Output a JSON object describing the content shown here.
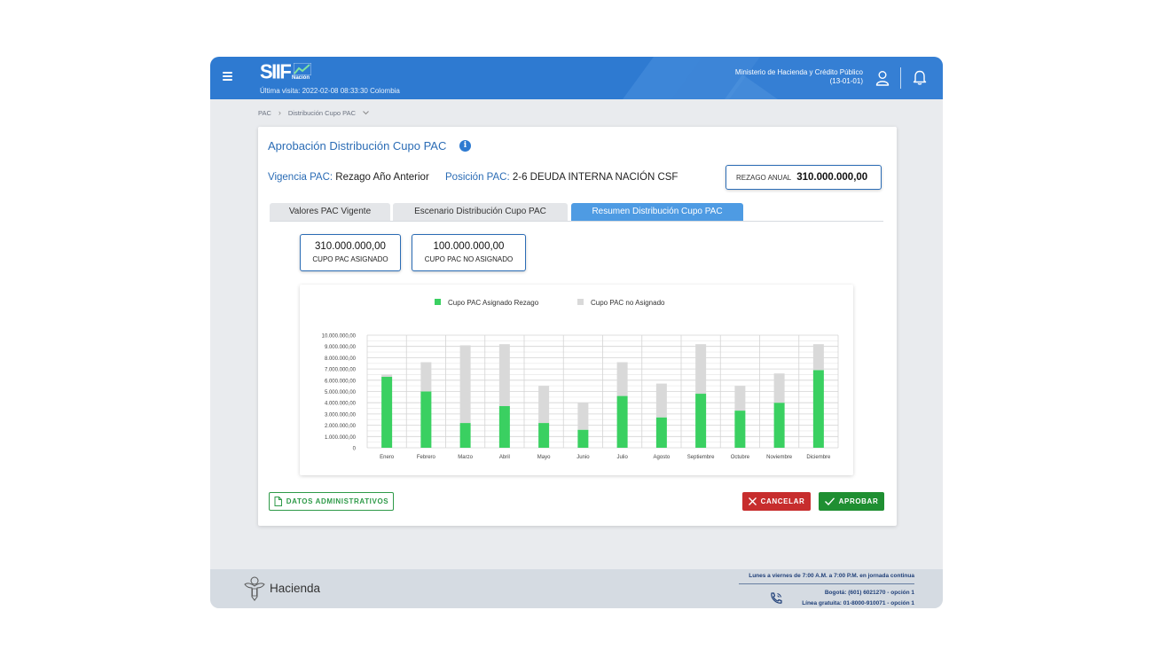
{
  "header": {
    "logo_text": "SIIF",
    "logo_subtext": "Nación",
    "last_visit": "Última visita: 2022-02-08 08:33:30 Colombia",
    "ministry_line1": "Ministerio de Hacienda y Crédito Público",
    "ministry_line2": "(13-01-01)",
    "icons": {
      "menu": "hamburger-menu-icon",
      "user": "user-icon",
      "notifications": "bell-icon"
    }
  },
  "breadcrumb": {
    "items": [
      "PAC",
      "Distribución Cupo PAC"
    ],
    "separator": "›"
  },
  "card": {
    "title": "Aprobación Distribución Cupo PAC",
    "info_icon": "i",
    "vigencia_label": "Vigencia PAC:",
    "vigencia_value": "Rezago Año Anterior",
    "posicion_label": "Posición PAC:",
    "posicion_value": "2-6 DEUDA INTERNA NACIÓN CSF",
    "rezago_label": "REZAGO ANUAL",
    "rezago_value": "310.000.000,00"
  },
  "tabs": [
    {
      "label": "Valores PAC Vigente",
      "active": false
    },
    {
      "label": "Escenario Distribución Cupo PAC",
      "active": false
    },
    {
      "label": "Resumen Distribución Cupo PAC",
      "active": true
    }
  ],
  "summary": {
    "assigned_value": "310.000.000,00",
    "assigned_label": "CUPO PAC ASIGNADO",
    "unassigned_value": "100.000.000,00",
    "unassigned_label": "CUPO PAC NO ASIGNADO"
  },
  "chart_data": {
    "type": "bar",
    "stacked": true,
    "categories": [
      "Enero",
      "Febrero",
      "Marzo",
      "Abril",
      "Mayo",
      "Junio",
      "Julio",
      "Agosto",
      "Septiembre",
      "Octubre",
      "Noviembre",
      "Diciembre"
    ],
    "series": [
      {
        "name": "Cupo PAC Asignado Rezago",
        "color": "#3ad061",
        "values": [
          6300000,
          5000000,
          2200000,
          3700000,
          2200000,
          1600000,
          4600000,
          2700000,
          4800000,
          3300000,
          4000000,
          6900000
        ]
      },
      {
        "name": "Cupo PAC no Asignado",
        "color": "#d9d9d9",
        "values": [
          200000,
          2600000,
          6900000,
          5500000,
          3300000,
          2400000,
          3000000,
          3000000,
          4400000,
          2200000,
          2600000,
          2300000
        ]
      }
    ],
    "ylim": [
      0,
      10000000
    ],
    "yticks": [
      "0",
      "1.000.000,00",
      "2.000.000,00",
      "3.000.000,00",
      "4.000.000,00",
      "5.000.000,00",
      "6.000.000,00",
      "7.000.000,00",
      "8.000.000,00",
      "9.000.000,00",
      "10.000.000,00"
    ],
    "legend": "top-center",
    "grid": true
  },
  "actions": {
    "admin_label": "DATOS ADMINISTRATIVOS",
    "cancel_label": "CANCELAR",
    "approve_label": "APROBAR",
    "admin_icon": "document-icon",
    "cancel_icon": "close-icon",
    "approve_icon": "check-icon"
  },
  "footer": {
    "brand": "Hacienda",
    "hours": "Lunes a viernes de 7:00 A.M. a 7:00 P.M. en jornada continua",
    "phone1": "Bogotá: (601) 6021270 - opción 1",
    "phone2": "Línea gratuita: 01-8000-910071 - opción 1"
  }
}
